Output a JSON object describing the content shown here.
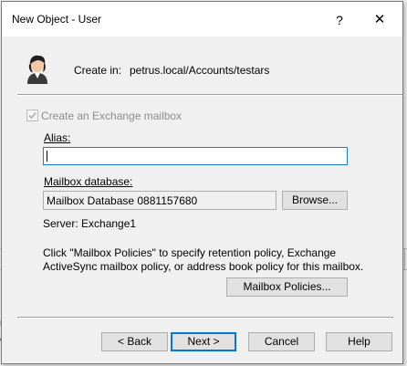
{
  "window": {
    "title": "New Object - User",
    "help_glyph": "?",
    "close_glyph": "✕"
  },
  "header": {
    "create_in_label": "Create in:",
    "create_in_path": "petrus.local/Accounts/testars"
  },
  "exchange": {
    "checkbox_label": "Create an Exchange mailbox",
    "checkbox_checked": true,
    "checkbox_enabled": false,
    "alias_label": "Alias:",
    "alias_value": "",
    "mailbox_db_label": "Mailbox database:",
    "mailbox_db_value": "Mailbox Database 0881157680",
    "browse_label": "Browse...",
    "server_text": "Server: Exchange1",
    "policy_info_line1": "Click \"Mailbox Policies\" to specify retention policy, Exchange",
    "policy_info_line2": "ActiveSync mailbox policy, or address book policy for this mailbox.",
    "mailbox_policies_label": "Mailbox Policies..."
  },
  "footer": {
    "back_label": "< Back",
    "next_label": "Next >",
    "cancel_label": "Cancel",
    "help_label": "Help"
  },
  "background": {
    "fragment1": "n",
    "fragment2": "e"
  },
  "icons": {
    "avatar": "user-avatar-icon",
    "checkmark": "checkmark-icon"
  }
}
